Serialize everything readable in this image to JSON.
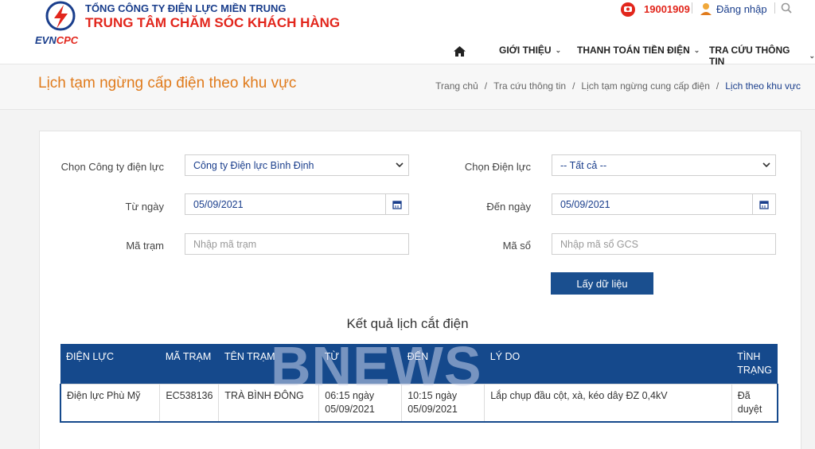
{
  "header": {
    "company_line": "TỔNG CÔNG TY ĐIỆN LỰC MIỀN TRUNG",
    "center_line": "TRUNG TÂM CHĂM SÓC KHÁCH HÀNG",
    "brand_evn": "EVN",
    "brand_cpc": "CPC",
    "hotline": "19001909",
    "login": "Đăng nhập",
    "colors": {
      "primary": "#1a3e8c",
      "accent": "#e2261c",
      "title": "#e07b1c"
    }
  },
  "nav": {
    "home_icon": "home-icon",
    "items": [
      {
        "label": "GIỚI THIỆU"
      },
      {
        "label": "THANH TOÁN TIỀN ĐIỆN"
      },
      {
        "label": "TRA CỨU THÔNG TIN"
      }
    ]
  },
  "page": {
    "title": "Lịch tạm ngừng cấp điện theo khu vực",
    "breadcrumb": [
      "Trang chủ",
      "Tra cứu thông tin",
      "Lịch tạm ngừng cung cấp điện",
      "Lịch theo khu vực"
    ]
  },
  "form": {
    "company_label": "Chọn Công ty điện lực",
    "company_value": "Công ty Điện lực Bình Định",
    "unit_label": "Chọn Điện lực",
    "unit_value": "-- Tất cả --",
    "from_label": "Từ ngày",
    "from_value": "05/09/2021",
    "to_label": "Đến ngày",
    "to_value": "05/09/2021",
    "station_label": "Mã trạm",
    "station_placeholder": "Nhập mã trạm",
    "book_label": "Mã sổ",
    "book_placeholder": "Nhập mã sổ GCS",
    "submit_label": "Lấy dữ liệu"
  },
  "results": {
    "title": "Kết quả lịch cắt điện",
    "columns": [
      "ĐIỆN LỰC",
      "MÃ TRẠM",
      "TÊN TRẠM",
      "TỪ",
      "ĐẾN",
      "LÝ DO",
      "TÌNH TRẠNG"
    ],
    "rows": [
      [
        "Điện lực Phù Mỹ",
        "EC538136",
        "TRÀ BÌNH ĐÔNG",
        "06:15 ngày 05/09/2021",
        "10:15 ngày 05/09/2021",
        "Lắp chụp đầu cột, xà, kéo dây ĐZ 0,4kV",
        "Đã duyệt"
      ]
    ]
  },
  "watermark": "BNEWS"
}
